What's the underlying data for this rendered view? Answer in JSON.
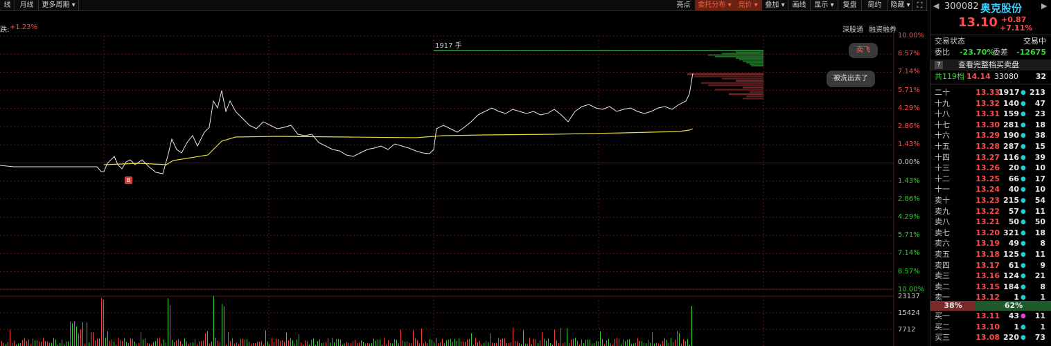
{
  "toolbar": {
    "left": [
      "线",
      "月线",
      "更多周期 ▾"
    ],
    "right": [
      "亮点",
      "委托分布 ▾",
      "竞价 ▾",
      "叠加 ▾",
      "画线",
      "显示 ▾",
      "复盘",
      "简约",
      "隐藏 ▾"
    ]
  },
  "info": {
    "change_label": "跌:",
    "change_value": "+1.23%",
    "links": [
      "深股通",
      "融资融券"
    ]
  },
  "chart": {
    "right_axis": [
      "10.00%",
      "8.57%",
      "7.14%",
      "5.71%",
      "4.29%",
      "2.86%",
      "1.43%",
      "0.00%",
      "1.43%",
      "2.86%",
      "4.29%",
      "5.71%",
      "7.14%",
      "8.57%",
      "10.00%"
    ],
    "order_label": "1917 手",
    "popup_sell": "卖飞",
    "popup_wash": "被洗出去了",
    "buy_marker": "B",
    "volume_axis": [
      "23137",
      "15424",
      "7712"
    ],
    "colors": {
      "price_line": "#ffffff",
      "avg_line": "#e6dc3c",
      "up": "#ff3a3a",
      "down": "#2fd22f"
    }
  },
  "stock": {
    "code": "300082",
    "name": "奥克股份",
    "price": "13.10",
    "change": "+0.87",
    "change_pct": "+7.11%",
    "status_label": "交易状态",
    "status_value": "交易中",
    "ratio_label": "委比",
    "ratio_value": "-23.70%",
    "diff_label": "委差",
    "diff_value": "-12675",
    "help_icon": "?",
    "full_book": "查看完整档买卖盘",
    "total_label": "共119档",
    "total_price": "14.14",
    "total_vol": "33080",
    "total_cnt": "32"
  },
  "asks": [
    {
      "label": "二十",
      "price": "13.33",
      "vol": "1917",
      "dot": "●",
      "cnt": "213"
    },
    {
      "label": "十九",
      "price": "13.32",
      "vol": "140",
      "dot": "●",
      "cnt": "47"
    },
    {
      "label": "十八",
      "price": "13.31",
      "vol": "159",
      "dot": "●",
      "cnt": "23"
    },
    {
      "label": "十七",
      "price": "13.30",
      "vol": "281",
      "dot": "●",
      "cnt": "18"
    },
    {
      "label": "十六",
      "price": "13.29",
      "vol": "190",
      "dot": "●",
      "cnt": "38"
    },
    {
      "label": "十五",
      "price": "13.28",
      "vol": "287",
      "dot": "●",
      "cnt": "15"
    },
    {
      "label": "十四",
      "price": "13.27",
      "vol": "116",
      "dot": "●",
      "cnt": "39"
    },
    {
      "label": "十三",
      "price": "13.26",
      "vol": "20",
      "dot": "●",
      "cnt": "10"
    },
    {
      "label": "十二",
      "price": "13.25",
      "vol": "66",
      "dot": "●",
      "cnt": "17"
    },
    {
      "label": "十一",
      "price": "13.24",
      "vol": "40",
      "dot": "●",
      "cnt": "10"
    },
    {
      "label": "卖十",
      "price": "13.23",
      "vol": "215",
      "dot": "●",
      "cnt": "54"
    },
    {
      "label": "卖九",
      "price": "13.22",
      "vol": "57",
      "dot": "●",
      "cnt": "11"
    },
    {
      "label": "卖八",
      "price": "13.21",
      "vol": "50",
      "dot": "●",
      "cnt": "50"
    },
    {
      "label": "卖七",
      "price": "13.20",
      "vol": "321",
      "dot": "●",
      "cnt": "18"
    },
    {
      "label": "卖六",
      "price": "13.19",
      "vol": "49",
      "dot": "●",
      "cnt": "8"
    },
    {
      "label": "卖五",
      "price": "13.18",
      "vol": "125",
      "dot": "●",
      "cnt": "11"
    },
    {
      "label": "卖四",
      "price": "13.17",
      "vol": "61",
      "dot": "●",
      "cnt": "9"
    },
    {
      "label": "卖三",
      "price": "13.16",
      "vol": "124",
      "dot": "●",
      "cnt": "21"
    },
    {
      "label": "卖二",
      "price": "13.15",
      "vol": "184",
      "dot": "●",
      "cnt": "8"
    },
    {
      "label": "卖一",
      "price": "13.12",
      "vol": "1",
      "dot": "●",
      "cnt": "1"
    }
  ],
  "ratio_bar": {
    "sell": "38%",
    "buy": "62%"
  },
  "bids": [
    {
      "label": "买一",
      "price": "13.11",
      "vol": "43",
      "dot": "●",
      "cnt": "11"
    },
    {
      "label": "买二",
      "price": "13.10",
      "vol": "1",
      "dot": "●",
      "cnt": "1"
    },
    {
      "label": "买三",
      "price": "13.08",
      "vol": "220",
      "dot": "●",
      "cnt": "73"
    }
  ]
}
